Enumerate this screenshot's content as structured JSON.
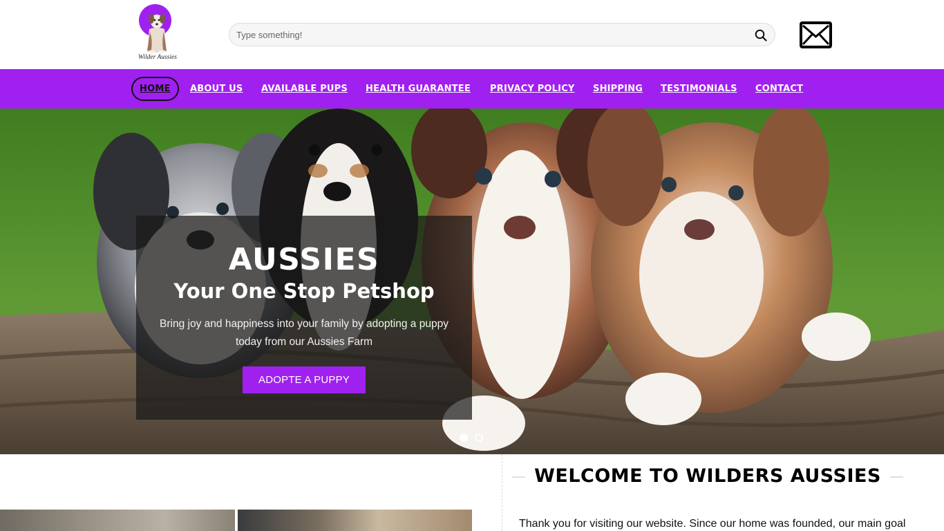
{
  "header": {
    "logo_text": "Wilder Aussies",
    "search": {
      "placeholder": "Type something!",
      "value": ""
    },
    "icons": {
      "search": "search-icon",
      "mail": "mail-icon"
    }
  },
  "nav": {
    "items": [
      {
        "label": "HOME",
        "active": true
      },
      {
        "label": "ABOUT US"
      },
      {
        "label": "AVAILABLE PUPS"
      },
      {
        "label": "HEALTH GUARANTEE"
      },
      {
        "label": "PRIVACY POLICY"
      },
      {
        "label": "SHIPPING"
      },
      {
        "label": "TESTIMONIALS"
      },
      {
        "label": "CONTACT"
      }
    ]
  },
  "hero": {
    "title": "AUSSIES",
    "subtitle": "Your One Stop Petshop",
    "description": "Bring joy and happiness into your family by adopting a puppy today from our Aussies Farm",
    "button_label": "ADOPTE A PUPPY",
    "slides": {
      "count": 2,
      "active": 1
    }
  },
  "welcome": {
    "heading": "WELCOME TO WILDERS AUSSIES",
    "intro": "Thank you for visiting our website. Since our home was founded, our main goal"
  },
  "colors": {
    "brand_purple": "#a020f0",
    "overlay": "#191919",
    "text_dark": "#111111"
  }
}
